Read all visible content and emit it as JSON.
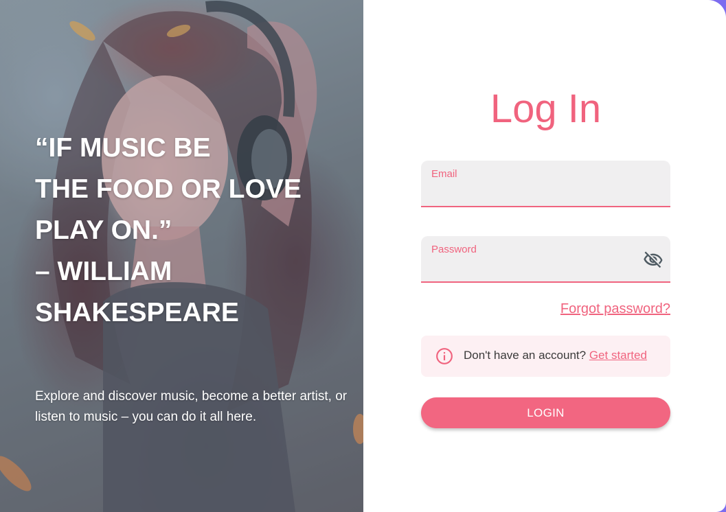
{
  "hero": {
    "quote": "“If music be\nthe food or love\nplay on.”\n– William\nShakespeare",
    "tagline": "Explore and discover music, become a better artist, or listen to music – you can do it all here."
  },
  "form": {
    "title": "Log In",
    "email": {
      "label": "Email",
      "value": ""
    },
    "password": {
      "label": "Password",
      "value": "",
      "toggle_icon": "eye-off-icon"
    },
    "forgot_label": "Forgot password?",
    "signup_prompt": "Don't have an account?",
    "signup_link": "Get started",
    "info_icon": "info-circle-icon",
    "login_label": "Login"
  },
  "colors": {
    "accent": "#f0637e",
    "field_bg": "#f0eff0",
    "info_bg": "#fdf0f3",
    "button": "#f26681"
  }
}
